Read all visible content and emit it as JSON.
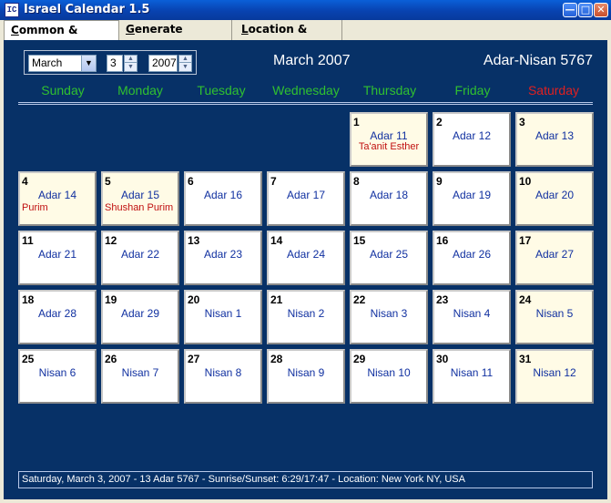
{
  "window": {
    "title": "Israel Calendar 1.5",
    "icon_label": "IC"
  },
  "tabs": [
    {
      "label_ul": "C",
      "label_rest": "ommon & Hebrew"
    },
    {
      "label_ul": "G",
      "label_rest": "enerate calendar"
    },
    {
      "label_ul": "L",
      "label_rest": "ocation & About"
    }
  ],
  "controls": {
    "month": "March",
    "day": "3",
    "year": "2007"
  },
  "header": {
    "month_title": "March 2007",
    "hebrew_title": "Adar-Nisan 5767"
  },
  "weekdays": [
    "Sunday",
    "Monday",
    "Tuesday",
    "Wednesday",
    "Thursday",
    "Friday",
    "Saturday"
  ],
  "days": [
    {
      "num": "1",
      "heb": "Adar 11",
      "holiday": "Ta'anit Esther",
      "hl": true
    },
    {
      "num": "2",
      "heb": "Adar 12"
    },
    {
      "num": "3",
      "heb": "Adar 13",
      "hl": true
    },
    {
      "num": "4",
      "heb": "Adar 14",
      "holiday": "Purim",
      "hl": true
    },
    {
      "num": "5",
      "heb": "Adar 15",
      "holiday": "Shushan Purim",
      "hl": true
    },
    {
      "num": "6",
      "heb": "Adar 16"
    },
    {
      "num": "7",
      "heb": "Adar 17"
    },
    {
      "num": "8",
      "heb": "Adar 18"
    },
    {
      "num": "9",
      "heb": "Adar 19"
    },
    {
      "num": "10",
      "heb": "Adar 20",
      "hl": true
    },
    {
      "num": "11",
      "heb": "Adar 21"
    },
    {
      "num": "12",
      "heb": "Adar 22"
    },
    {
      "num": "13",
      "heb": "Adar 23"
    },
    {
      "num": "14",
      "heb": "Adar 24"
    },
    {
      "num": "15",
      "heb": "Adar 25"
    },
    {
      "num": "16",
      "heb": "Adar 26"
    },
    {
      "num": "17",
      "heb": "Adar 27",
      "hl": true
    },
    {
      "num": "18",
      "heb": "Adar 28"
    },
    {
      "num": "19",
      "heb": "Adar 29"
    },
    {
      "num": "20",
      "heb": "Nisan 1"
    },
    {
      "num": "21",
      "heb": "Nisan 2"
    },
    {
      "num": "22",
      "heb": "Nisan 3"
    },
    {
      "num": "23",
      "heb": "Nisan 4"
    },
    {
      "num": "24",
      "heb": "Nisan 5",
      "hl": true
    },
    {
      "num": "25",
      "heb": "Nisan 6"
    },
    {
      "num": "26",
      "heb": "Nisan 7"
    },
    {
      "num": "27",
      "heb": "Nisan 8"
    },
    {
      "num": "28",
      "heb": "Nisan 9"
    },
    {
      "num": "29",
      "heb": "Nisan 10"
    },
    {
      "num": "30",
      "heb": "Nisan 11"
    },
    {
      "num": "31",
      "heb": "Nisan 12",
      "hl": true
    }
  ],
  "status": "Saturday, March 3, 2007 - 13 Adar 5767 - Sunrise/Sunset: 6:29/17:47 - Location: New York NY, USA",
  "colors": {
    "panel_bg": "#073167",
    "weekday_green": "#30c030",
    "saturday_red": "#e02020",
    "hebrew_blue": "#1030a0",
    "holiday_red": "#c01010",
    "highlight_cell": "#fffbe6"
  }
}
